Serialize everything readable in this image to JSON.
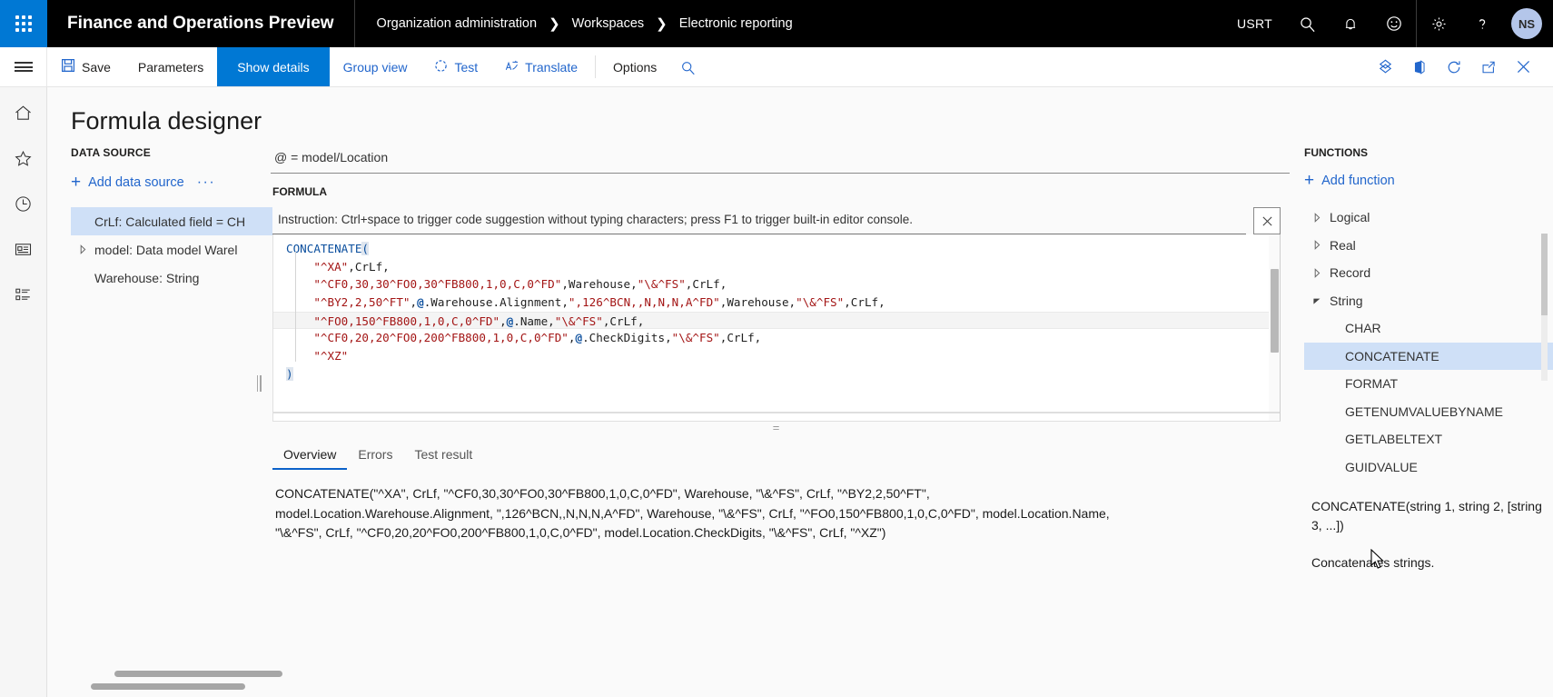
{
  "topbar": {
    "waffle_icon": "app-launcher-icon",
    "app_title": "Finance and Operations Preview",
    "breadcrumb": [
      "Organization administration",
      "Workspaces",
      "Electronic reporting"
    ],
    "company": "USRT",
    "icons": [
      "search-icon",
      "notifications-bell-icon",
      "feedback-smiley-icon",
      "settings-gear-icon",
      "help-question-icon"
    ],
    "avatar_initials": "NS"
  },
  "commandbar": {
    "menu_icon": "hamburger-menu-icon",
    "save_label": "Save",
    "parameters_label": "Parameters",
    "show_details_label": "Show details",
    "group_view_label": "Group view",
    "test_label": "Test",
    "translate_label": "Translate",
    "options_label": "Options",
    "search_icon": "search-icon",
    "right_icons": [
      "attachments-icon",
      "office-export-icon",
      "refresh-icon",
      "open-in-new-window-icon",
      "close-icon"
    ]
  },
  "leftrail": {
    "items": [
      "home-icon",
      "favorites-star-icon",
      "recent-clock-icon",
      "workspaces-icon",
      "modules-list-icon"
    ]
  },
  "page": {
    "title": "Formula designer"
  },
  "datasource": {
    "header": "DATA SOURCE",
    "add_label": "Add data source",
    "more_label": "···",
    "items": [
      {
        "label": "CrLf: Calculated field = CH",
        "selected": true,
        "has_caret": false
      },
      {
        "label": "model: Data model Warel",
        "selected": false,
        "has_caret": true
      },
      {
        "label": "Warehouse: String",
        "selected": false,
        "has_caret": false
      }
    ]
  },
  "formula": {
    "binding_line": "@ = model/Location",
    "section_header": "FORMULA",
    "instruction": "Instruction: Ctrl+space to trigger code suggestion without typing characters; press F1 to trigger built-in editor console.",
    "close_icon": "close-icon",
    "code_lines": [
      [
        {
          "t": "CONCATENATE",
          "c": "fn"
        },
        {
          "t": "(",
          "c": "brk"
        }
      ],
      [
        {
          "t": "    ",
          "c": "op"
        },
        {
          "t": "\"^XA\"",
          "c": "str"
        },
        {
          "t": ",CrLf,",
          "c": "op"
        }
      ],
      [
        {
          "t": "    ",
          "c": "op"
        },
        {
          "t": "\"^CF0,30,30^FO0,30^FB800,1,0,C,0^FD\"",
          "c": "str"
        },
        {
          "t": ",Warehouse,",
          "c": "op"
        },
        {
          "t": "\"\\&^FS\"",
          "c": "str"
        },
        {
          "t": ",CrLf,",
          "c": "op"
        }
      ],
      [
        {
          "t": "    ",
          "c": "op"
        },
        {
          "t": "\"^BY2,2,50^FT\"",
          "c": "str"
        },
        {
          "t": ",",
          "c": "op"
        },
        {
          "t": "@",
          "c": "at"
        },
        {
          "t": ".Warehouse.Alignment,",
          "c": "op"
        },
        {
          "t": "\",126^BCN,,N,N,N,A^FD\"",
          "c": "str"
        },
        {
          "t": ",Warehouse,",
          "c": "op"
        },
        {
          "t": "\"\\&^FS\"",
          "c": "str"
        },
        {
          "t": ",CrLf,",
          "c": "op"
        }
      ],
      [
        {
          "t": "    ",
          "c": "op"
        },
        {
          "t": "\"^FO0,150^FB800,1,0,C,0^FD\"",
          "c": "str"
        },
        {
          "t": ",",
          "c": "op"
        },
        {
          "t": "@",
          "c": "at"
        },
        {
          "t": ".Name,",
          "c": "op"
        },
        {
          "t": "\"\\&^FS\"",
          "c": "str"
        },
        {
          "t": ",CrLf,",
          "c": "op"
        }
      ],
      [
        {
          "t": "    ",
          "c": "op"
        },
        {
          "t": "\"^CF0,20,20^FO0,200^FB800,1,0,C,0^FD\"",
          "c": "str"
        },
        {
          "t": ",",
          "c": "op"
        },
        {
          "t": "@",
          "c": "at"
        },
        {
          "t": ".CheckDigits,",
          "c": "op"
        },
        {
          "t": "\"\\&^FS\"",
          "c": "str"
        },
        {
          "t": ",CrLf,",
          "c": "op"
        }
      ],
      [
        {
          "t": "    ",
          "c": "op"
        },
        {
          "t": "\"^XZ\"",
          "c": "str"
        }
      ],
      [
        {
          "t": ")",
          "c": "brk"
        }
      ]
    ],
    "current_line_index": 4
  },
  "result_tabs": {
    "tabs": [
      "Overview",
      "Errors",
      "Test result"
    ],
    "active": "Overview",
    "overview_text": "CONCATENATE(\"^XA\", CrLf, \"^CF0,30,30^FO0,30^FB800,1,0,C,0^FD\", Warehouse, \"\\&^FS\", CrLf, \"^BY2,2,50^FT\", model.Location.Warehouse.Alignment, \",126^BCN,,N,N,N,A^FD\", Warehouse, \"\\&^FS\", CrLf, \"^FO0,150^FB800,1,0,C,0^FD\", model.Location.Name, \"\\&^FS\", CrLf, \"^CF0,20,20^FO0,200^FB800,1,0,C,0^FD\", model.Location.CheckDigits, \"\\&^FS\", CrLf, \"^XZ\")"
  },
  "functions": {
    "header": "FUNCTIONS",
    "add_label": "Add function",
    "categories": [
      {
        "label": "Logical",
        "expanded": false
      },
      {
        "label": "Real",
        "expanded": false
      },
      {
        "label": "Record",
        "expanded": false
      },
      {
        "label": "String",
        "expanded": true
      }
    ],
    "string_items": [
      {
        "label": "CHAR",
        "selected": false
      },
      {
        "label": "CONCATENATE",
        "selected": true
      },
      {
        "label": "FORMAT",
        "selected": false
      },
      {
        "label": "GETENUMVALUEBYNAME",
        "selected": false
      },
      {
        "label": "GETLABELTEXT",
        "selected": false
      },
      {
        "label": "GUIDVALUE",
        "selected": false
      }
    ],
    "signature": "CONCATENATE(string 1, string 2, [string 3, ...])",
    "description": "Concatenates strings."
  },
  "colors": {
    "accent": "#0078d4",
    "link": "#2266cc",
    "selection": "#cfe0f7",
    "topbar_bg": "#000000",
    "string_token": "#a31515",
    "function_token": "#0b4f9e"
  }
}
